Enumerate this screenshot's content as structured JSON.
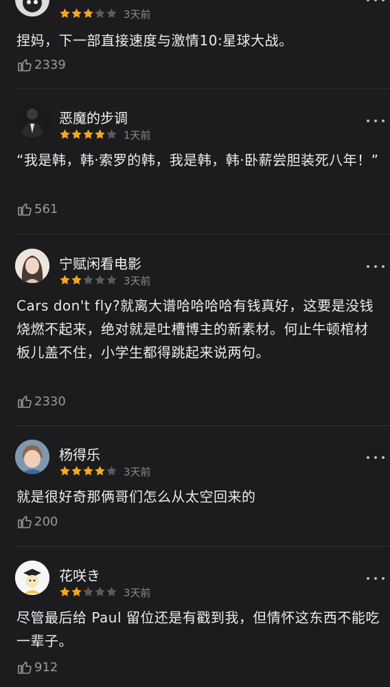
{
  "comments": [
    {
      "username": "",
      "rating": 3,
      "time": "3天前",
      "text": "捏妈，下一部直接速度与激情10:星球大战。",
      "likes": "2339",
      "avatar_icon": "dark-avatar-icon"
    },
    {
      "username": "恶魔的步调",
      "rating": 4,
      "time": "1天前",
      "text": "“我是韩，韩·索罗的韩，我是韩，韩·卧薪尝胆装死八年！”",
      "likes": "561",
      "avatar_icon": "suit-man-avatar-icon"
    },
    {
      "username": "宁赋闲看电影",
      "rating": 2,
      "time": "3天前",
      "text": "Cars don't fly?就离大谱哈哈哈哈有钱真好，这要是没钱烧燃不起来，绝对就是吐槽博主的新素材。何止牛顿棺材板儿盖不住，小学生都得跳起来说两句。",
      "likes": "2330",
      "avatar_icon": "girl-avatar-icon"
    },
    {
      "username": "杨得乐",
      "rating": 4,
      "time": "3天前",
      "text": "就是很好奇那俩哥们怎么从太空回来的",
      "likes": "200",
      "avatar_icon": "child-avatar-icon"
    },
    {
      "username": "花咲き",
      "rating": 2,
      "time": "3天前",
      "text": "尽管最后给 Paul 留位还是有戳到我，但情怀这东西不能吃一辈子。",
      "likes": "912",
      "avatar_icon": "cartoon-avatar-icon"
    }
  ],
  "colors": {
    "background": "#1c1c1e",
    "star_filled": "#f5a623",
    "star_empty": "#5a5a5e",
    "secondary_text": "#8a8a8e"
  }
}
